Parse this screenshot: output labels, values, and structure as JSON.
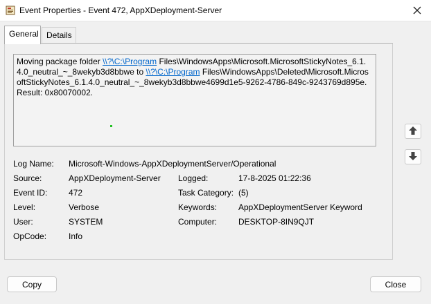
{
  "window": {
    "title": "Event Properties - Event 472, AppXDeployment-Server",
    "icon": "event-viewer-icon",
    "close_icon": "close-icon"
  },
  "tabs": [
    {
      "label": "General",
      "active": true
    },
    {
      "label": "Details",
      "active": false
    }
  ],
  "description": {
    "t1": "Moving package folder ",
    "link1": "\\\\?\\C:\\Program",
    "t2": " Files\\WindowsApps\\Microsoft.MicrosoftStickyNotes_6.1.4.0_neutral_~_8wekyb3d8bbwe to ",
    "link2": "\\\\?\\C:\\Program",
    "t3": " Files\\WindowsApps\\Deleted\\Microsoft.MicrosoftStickyNotes_6.1.4.0_neutral_~_8wekyb3d8bbwe4699d1e5-9262-4786-849c-9243769d895e. Result: 0x80070002."
  },
  "fields": {
    "log_name_label": "Log Name:",
    "log_name_value": "Microsoft-Windows-AppXDeploymentServer/Operational",
    "source_label": "Source:",
    "source_value": "AppXDeployment-Server",
    "logged_label": "Logged:",
    "logged_value": "17-8-2025 01:22:36",
    "event_id_label": "Event ID:",
    "event_id_value": "472",
    "task_category_label": "Task Category:",
    "task_category_value": "(5)",
    "level_label": "Level:",
    "level_value": "Verbose",
    "keywords_label": "Keywords:",
    "keywords_value": "AppXDeploymentServer Keyword",
    "user_label": "User:",
    "user_value": "SYSTEM",
    "computer_label": "Computer:",
    "computer_value": "DESKTOP-8IN9QJT",
    "opcode_label": "OpCode:",
    "opcode_value": "Info"
  },
  "side_buttons": {
    "up_icon": "arrow-up-icon",
    "down_icon": "arrow-down-icon"
  },
  "buttons": {
    "copy": "Copy",
    "close": "Close"
  },
  "colors": {
    "link": "#0066cc",
    "dot": "#22c022"
  }
}
